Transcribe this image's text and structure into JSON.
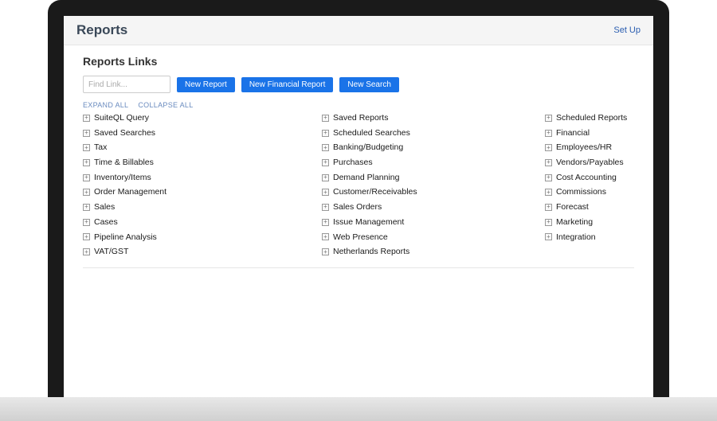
{
  "header": {
    "title": "Reports",
    "setup": "Set Up"
  },
  "section": {
    "title": "Reports Links"
  },
  "toolbar": {
    "find_placeholder": "Find Link...",
    "new_report": "New Report",
    "new_financial": "New Financial Report",
    "new_search": "New Search"
  },
  "controls": {
    "expand_all": "EXPAND ALL",
    "collapse_all": "COLLAPSE ALL"
  },
  "columns": {
    "col1": [
      "SuiteQL Query",
      "Saved Searches",
      "Tax",
      "Time & Billables",
      "Inventory/Items",
      "Order Management",
      "Sales",
      "Cases",
      "Pipeline Analysis",
      "VAT/GST"
    ],
    "col2": [
      "Saved Reports",
      "Scheduled Searches",
      "Banking/Budgeting",
      "Purchases",
      "Demand Planning",
      "Customer/Receivables",
      "Sales Orders",
      "Issue Management",
      "Web Presence",
      "Netherlands Reports"
    ],
    "col3": [
      "Scheduled Reports",
      "Financial",
      "Employees/HR",
      "Vendors/Payables",
      "Cost Accounting",
      "Commissions",
      "Forecast",
      "Marketing",
      "Integration"
    ]
  }
}
